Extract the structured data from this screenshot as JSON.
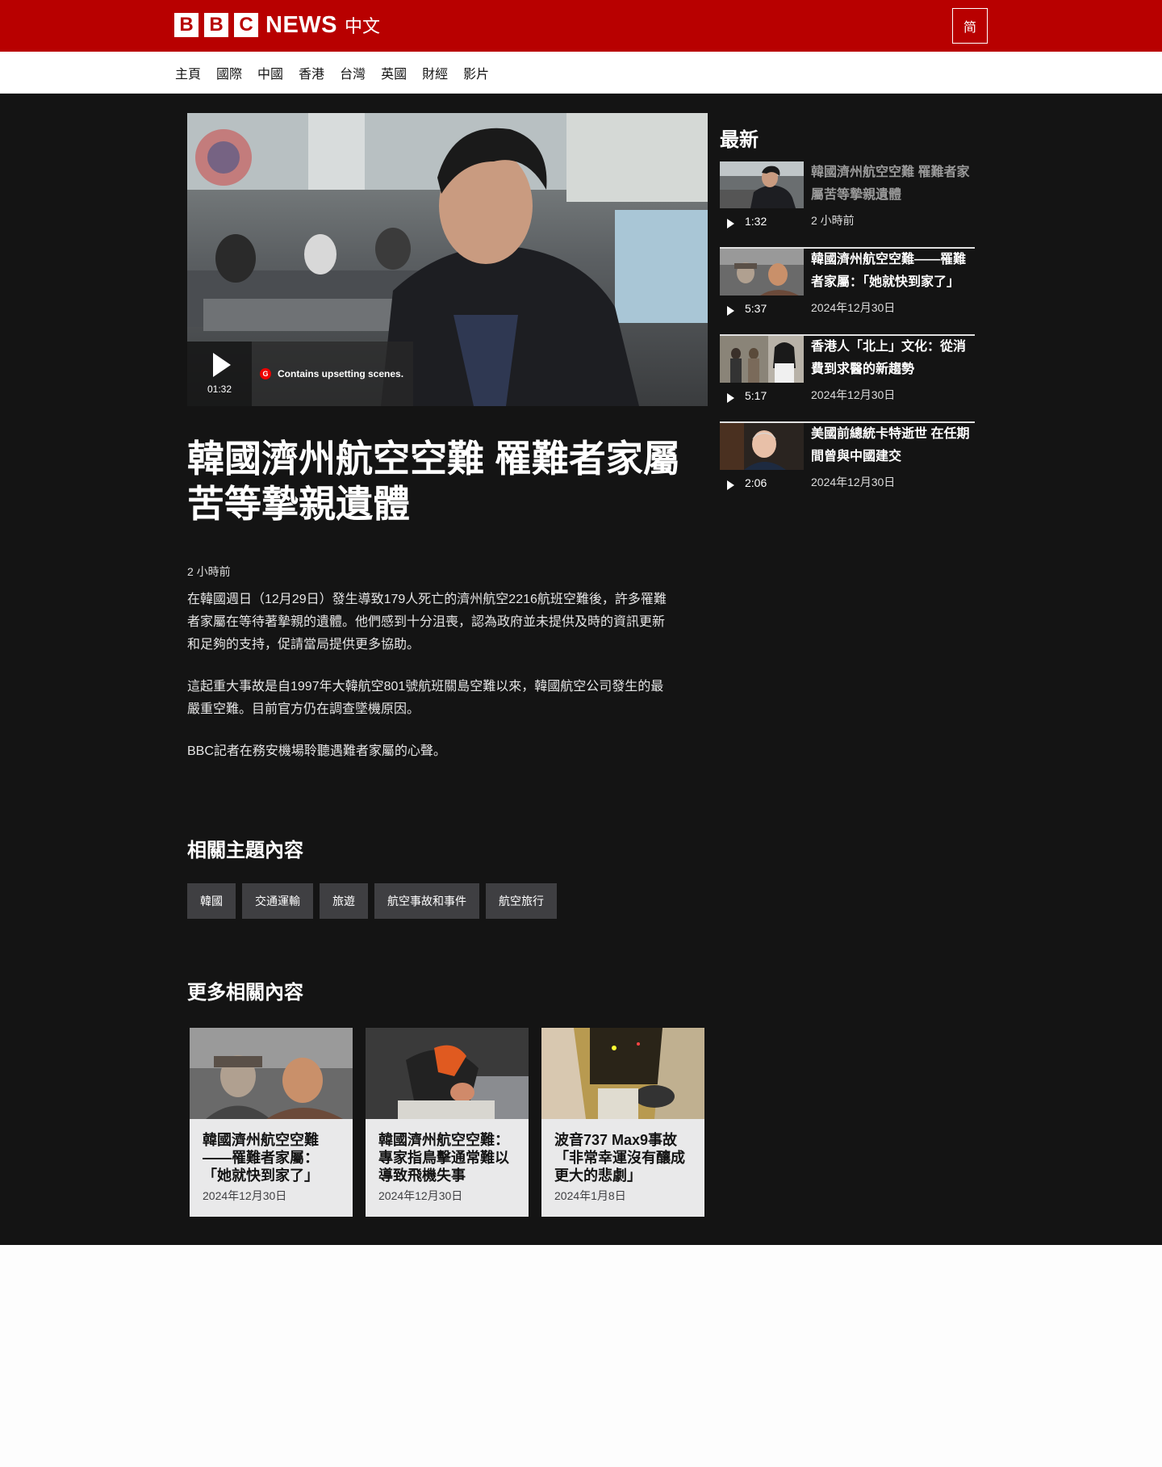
{
  "header": {
    "logo_letters": [
      "B",
      "B",
      "C"
    ],
    "logo_news": "NEWS",
    "logo_chinese": "中文",
    "language_toggle": "简",
    "brand_color": "#b80000"
  },
  "nav": {
    "items": [
      "主頁",
      "國際",
      "中國",
      "香港",
      "台灣",
      "英國",
      "財經",
      "影片"
    ]
  },
  "video": {
    "duration": "01:32",
    "warning_badge": "G",
    "warning_text": "Contains upsetting scenes."
  },
  "article": {
    "headline": "韓國濟州航空空難 罹難者家屬苦等摯親遺體",
    "timestamp": "2 小時前",
    "paragraphs": [
      "在韓國週日（12月29日）發生導致179人死亡的濟州航空2216航班空難後，許多罹難者家屬在等待著摯親的遺體。他們感到十分沮喪，認為政府並未提供及時的資訊更新和足夠的支持，促請當局提供更多協助。",
      "這起重大事故是自1997年大韓航空801號航班關島空難以來，韓國航空公司發生的最嚴重空難。目前官方仍在調查墜機原因。",
      "BBC記者在務安機場聆聽遇難者家屬的心聲。"
    ]
  },
  "related_topics": {
    "heading": "相關主題內容",
    "tags": [
      "韓國",
      "交通運輸",
      "旅遊",
      "航空事故和事件",
      "航空旅行"
    ]
  },
  "more_related": {
    "heading": "更多相關內容",
    "cards": [
      {
        "title": "韓國濟州航空空難——罹難者家屬：「她就快到家了」",
        "date": "2024年12月30日"
      },
      {
        "title": "韓國濟州航空空難：專家指鳥擊通常難以導致飛機失事",
        "date": "2024年12月30日"
      },
      {
        "title": "波音737 Max9事故「非常幸運沒有釀成更大的悲劇」",
        "date": "2024年1月8日"
      }
    ]
  },
  "sidebar": {
    "heading": "最新",
    "items": [
      {
        "title": "韓國濟州航空空難 罹難者家屬苦等摯親遺體",
        "duration": "1:32",
        "date": "2 小時前",
        "current": true
      },
      {
        "title": "韓國濟州航空空難——罹難者家屬：「她就快到家了」",
        "duration": "5:37",
        "date": "2024年12月30日",
        "current": false
      },
      {
        "title": "香港人「北上」文化：從消費到求醫的新趨勢",
        "duration": "5:17",
        "date": "2024年12月30日",
        "current": false
      },
      {
        "title": "美國前總統卡特逝世 在任期間曾與中國建交",
        "duration": "2:06",
        "date": "2024年12月30日",
        "current": false
      }
    ]
  }
}
